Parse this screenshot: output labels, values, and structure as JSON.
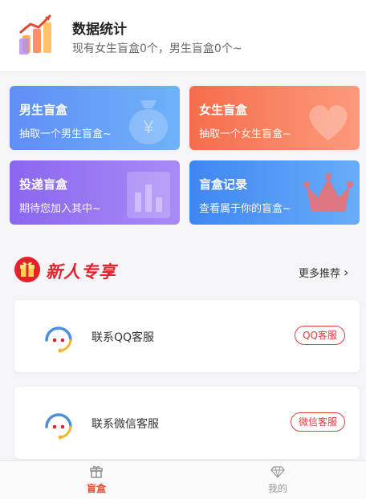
{
  "header": {
    "title": "数据统计",
    "subtitle": "现有女生盲盒0个，男生盲盒0个~",
    "icon": "bar-chart-icon"
  },
  "cards": [
    {
      "title": "男生盲盒",
      "subtitle": "抽取一个男生盲盒~",
      "icon": "money-bag-icon",
      "color": "#5f8ef5"
    },
    {
      "title": "女生盲盒",
      "subtitle": "抽取一个女生盲盒~",
      "icon": "heart-icon",
      "color": "#f56d4b"
    },
    {
      "title": "投递盲盒",
      "subtitle": "期待您加入其中~",
      "icon": "chart-icon",
      "color": "#8a66ef"
    },
    {
      "title": "盲盒记录",
      "subtitle": "查看属于你的盲盒~",
      "icon": "crown-icon",
      "color": "#3f86f3"
    }
  ],
  "promo": {
    "title": "新人专享",
    "more_label": "更多推荐",
    "icon": "gift-icon",
    "accent": "#e3232b"
  },
  "services": [
    {
      "label": "联系QQ客服",
      "button": "QQ客服",
      "icon": "headset-icon"
    },
    {
      "label": "联系微信客服",
      "button": "微信客服",
      "icon": "headset-icon"
    }
  ],
  "tabbar": {
    "items": [
      {
        "label": "盲盒",
        "icon": "gift-box-icon",
        "active": true,
        "color": "#e34a2e"
      },
      {
        "label": "我的",
        "icon": "diamond-icon",
        "active": false,
        "color": "#999999"
      }
    ]
  }
}
